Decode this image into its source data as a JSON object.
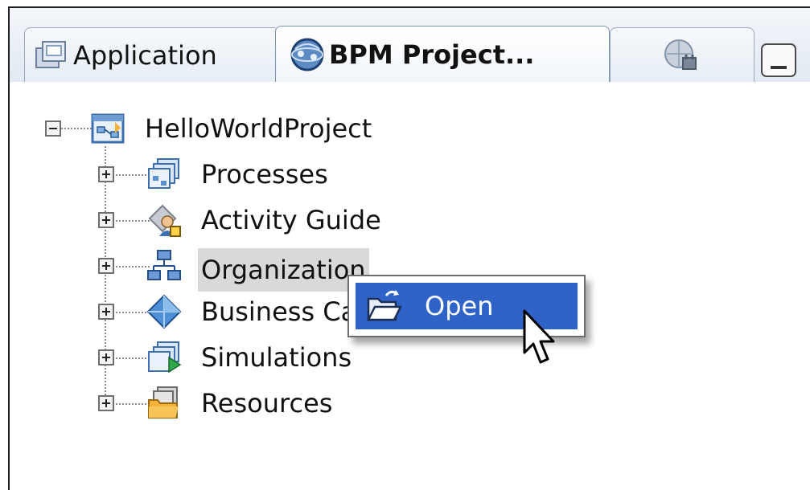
{
  "tabs": [
    {
      "label": "Application",
      "icon": "application-icon",
      "active": false
    },
    {
      "label": "BPM Project...",
      "icon": "bpm-project-icon",
      "active": true
    },
    {
      "label": "",
      "icon": "globe-plug-icon",
      "active": false
    }
  ],
  "tree": {
    "root": {
      "label": "HelloWorldProject",
      "icon": "project-icon",
      "expanded": true
    },
    "children": [
      {
        "label": "Processes",
        "icon": "processes-icon"
      },
      {
        "label": "Activity Guide",
        "icon": "activity-guide-icon"
      },
      {
        "label": "Organization",
        "icon": "organization-icon",
        "highlighted": true
      },
      {
        "label": "Business Ca",
        "icon": "business-catalog-icon"
      },
      {
        "label": "Simulations",
        "icon": "simulations-icon"
      },
      {
        "label": "Resources",
        "icon": "resources-icon"
      }
    ]
  },
  "context_menu": {
    "items": [
      {
        "label": "Open",
        "icon": "open-folder-icon",
        "selected": true
      }
    ]
  },
  "colors": {
    "selection": "#2f63c8",
    "highlight": "#d9d9d9",
    "tab_border": "#7d93b2"
  }
}
